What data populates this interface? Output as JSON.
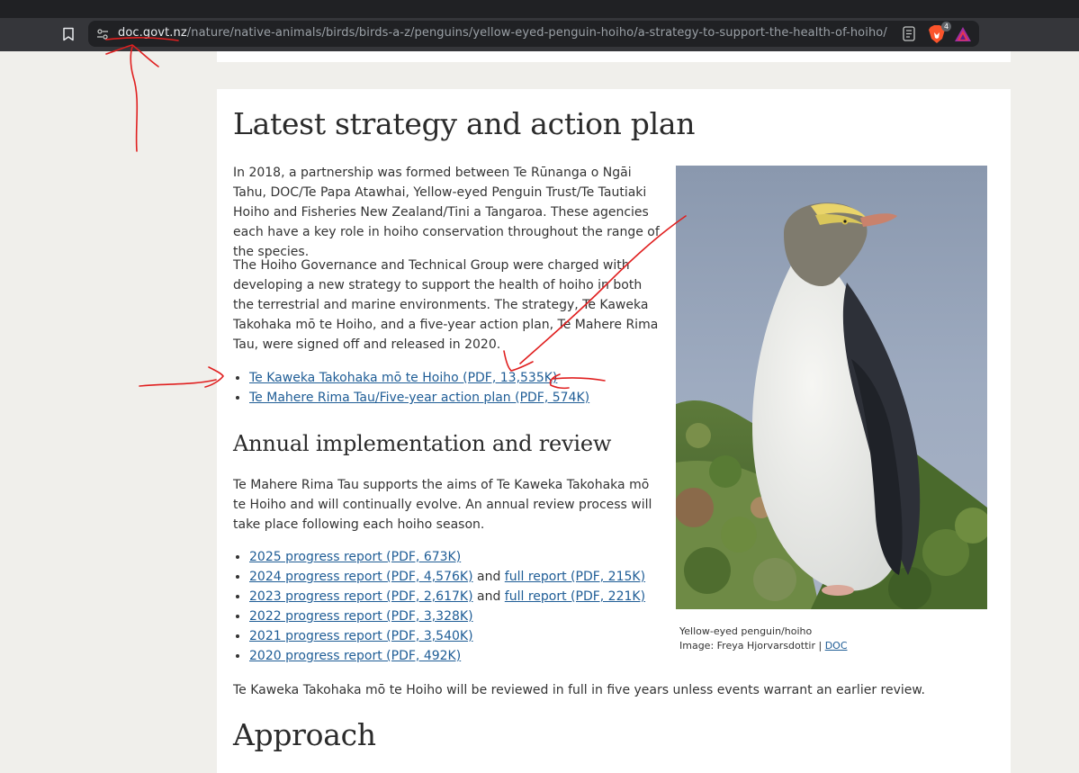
{
  "browser": {
    "url_host": "doc.govt.nz",
    "url_path": "/nature/native-animals/birds/birds-a-z/penguins/yellow-eyed-penguin-hoiho/a-strategy-to-support-the-health-of-hoiho/",
    "brave_shield_count": "4",
    "icons": [
      "bookmark-icon",
      "site-info-icon",
      "reader-mode-icon",
      "brave-shields-icon",
      "brave-rewards-icon"
    ]
  },
  "main": {
    "heading": "Latest strategy and action plan",
    "para1": "In 2018, a partnership was formed between Te Rūnanga o Ngāi Tahu, DOC/Te Papa Atawhai, Yellow-eyed Penguin Trust/Te Tautiaki Hoiho and Fisheries New Zealand/Tini a Tangaroa. These agencies each have a key role in hoiho conservation throughout the range of the species.",
    "para2": "The Hoiho Governance and Technical Group were charged with developing a new strategy to support the health of hoiho in both the terrestrial and marine environments. The strategy, Te Kaweka Takohaka mō te Hoiho, and a five-year action plan, Te Mahere Rima Tau, were signed off and released in 2020.",
    "plan_links": [
      "Te Kaweka Takohaka mō te Hoiho (PDF, 13,535K)",
      "Te Mahere Rima Tau/Five-year action plan (PDF, 574K)"
    ],
    "annual_heading": "Annual implementation and review",
    "para3": "Te Mahere Rima Tau supports the aims of Te Kaweka Takohaka mō te Hoiho and will continually evolve. An annual review process will take place following each hoiho season.",
    "reports": [
      {
        "report": "2025 progress report (PDF, 673K)"
      },
      {
        "report": "2024 progress report (PDF, 4,576K)",
        "joiner": " and ",
        "full": "full report (PDF, 215K)"
      },
      {
        "report": "2023 progress report (PDF, 2,617K)",
        "joiner": " and ",
        "full": "full report (PDF, 221K)"
      },
      {
        "report": "2022 progress report (PDF, 3,328K)"
      },
      {
        "report": "2021 progress report (PDF, 3,540K)"
      },
      {
        "report": "2020 progress report (PDF, 492K)"
      }
    ],
    "para4": "Te Kaweka Takohaka mō te Hoiho will be reviewed in full in five years unless events warrant an earlier review.",
    "approach_heading": "Approach"
  },
  "figure": {
    "caption_line1": "Yellow-eyed penguin/hoiho",
    "caption_line2": "Image: Freya Hjorvarsdottir | ",
    "caption_link": "DOC"
  },
  "colors": {
    "link": "#1f5d96",
    "annotation": "#e02020",
    "page_background": "#f0efeb"
  }
}
